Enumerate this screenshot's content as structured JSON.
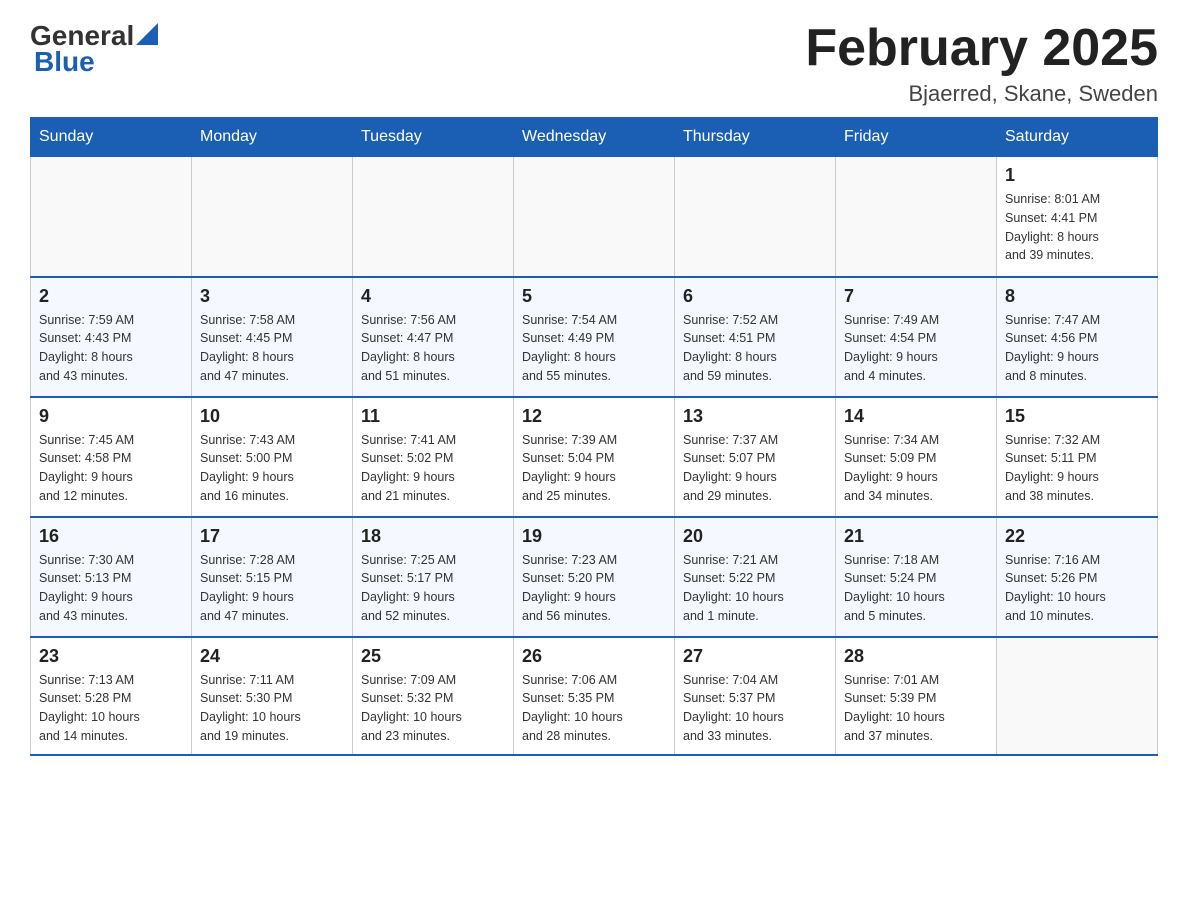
{
  "header": {
    "logo_general": "General",
    "logo_blue": "Blue",
    "month_title": "February 2025",
    "location": "Bjaerred, Skane, Sweden"
  },
  "weekdays": [
    "Sunday",
    "Monday",
    "Tuesday",
    "Wednesday",
    "Thursday",
    "Friday",
    "Saturday"
  ],
  "weeks": [
    {
      "days": [
        {
          "number": "",
          "info": ""
        },
        {
          "number": "",
          "info": ""
        },
        {
          "number": "",
          "info": ""
        },
        {
          "number": "",
          "info": ""
        },
        {
          "number": "",
          "info": ""
        },
        {
          "number": "",
          "info": ""
        },
        {
          "number": "1",
          "info": "Sunrise: 8:01 AM\nSunset: 4:41 PM\nDaylight: 8 hours\nand 39 minutes."
        }
      ]
    },
    {
      "days": [
        {
          "number": "2",
          "info": "Sunrise: 7:59 AM\nSunset: 4:43 PM\nDaylight: 8 hours\nand 43 minutes."
        },
        {
          "number": "3",
          "info": "Sunrise: 7:58 AM\nSunset: 4:45 PM\nDaylight: 8 hours\nand 47 minutes."
        },
        {
          "number": "4",
          "info": "Sunrise: 7:56 AM\nSunset: 4:47 PM\nDaylight: 8 hours\nand 51 minutes."
        },
        {
          "number": "5",
          "info": "Sunrise: 7:54 AM\nSunset: 4:49 PM\nDaylight: 8 hours\nand 55 minutes."
        },
        {
          "number": "6",
          "info": "Sunrise: 7:52 AM\nSunset: 4:51 PM\nDaylight: 8 hours\nand 59 minutes."
        },
        {
          "number": "7",
          "info": "Sunrise: 7:49 AM\nSunset: 4:54 PM\nDaylight: 9 hours\nand 4 minutes."
        },
        {
          "number": "8",
          "info": "Sunrise: 7:47 AM\nSunset: 4:56 PM\nDaylight: 9 hours\nand 8 minutes."
        }
      ]
    },
    {
      "days": [
        {
          "number": "9",
          "info": "Sunrise: 7:45 AM\nSunset: 4:58 PM\nDaylight: 9 hours\nand 12 minutes."
        },
        {
          "number": "10",
          "info": "Sunrise: 7:43 AM\nSunset: 5:00 PM\nDaylight: 9 hours\nand 16 minutes."
        },
        {
          "number": "11",
          "info": "Sunrise: 7:41 AM\nSunset: 5:02 PM\nDaylight: 9 hours\nand 21 minutes."
        },
        {
          "number": "12",
          "info": "Sunrise: 7:39 AM\nSunset: 5:04 PM\nDaylight: 9 hours\nand 25 minutes."
        },
        {
          "number": "13",
          "info": "Sunrise: 7:37 AM\nSunset: 5:07 PM\nDaylight: 9 hours\nand 29 minutes."
        },
        {
          "number": "14",
          "info": "Sunrise: 7:34 AM\nSunset: 5:09 PM\nDaylight: 9 hours\nand 34 minutes."
        },
        {
          "number": "15",
          "info": "Sunrise: 7:32 AM\nSunset: 5:11 PM\nDaylight: 9 hours\nand 38 minutes."
        }
      ]
    },
    {
      "days": [
        {
          "number": "16",
          "info": "Sunrise: 7:30 AM\nSunset: 5:13 PM\nDaylight: 9 hours\nand 43 minutes."
        },
        {
          "number": "17",
          "info": "Sunrise: 7:28 AM\nSunset: 5:15 PM\nDaylight: 9 hours\nand 47 minutes."
        },
        {
          "number": "18",
          "info": "Sunrise: 7:25 AM\nSunset: 5:17 PM\nDaylight: 9 hours\nand 52 minutes."
        },
        {
          "number": "19",
          "info": "Sunrise: 7:23 AM\nSunset: 5:20 PM\nDaylight: 9 hours\nand 56 minutes."
        },
        {
          "number": "20",
          "info": "Sunrise: 7:21 AM\nSunset: 5:22 PM\nDaylight: 10 hours\nand 1 minute."
        },
        {
          "number": "21",
          "info": "Sunrise: 7:18 AM\nSunset: 5:24 PM\nDaylight: 10 hours\nand 5 minutes."
        },
        {
          "number": "22",
          "info": "Sunrise: 7:16 AM\nSunset: 5:26 PM\nDaylight: 10 hours\nand 10 minutes."
        }
      ]
    },
    {
      "days": [
        {
          "number": "23",
          "info": "Sunrise: 7:13 AM\nSunset: 5:28 PM\nDaylight: 10 hours\nand 14 minutes."
        },
        {
          "number": "24",
          "info": "Sunrise: 7:11 AM\nSunset: 5:30 PM\nDaylight: 10 hours\nand 19 minutes."
        },
        {
          "number": "25",
          "info": "Sunrise: 7:09 AM\nSunset: 5:32 PM\nDaylight: 10 hours\nand 23 minutes."
        },
        {
          "number": "26",
          "info": "Sunrise: 7:06 AM\nSunset: 5:35 PM\nDaylight: 10 hours\nand 28 minutes."
        },
        {
          "number": "27",
          "info": "Sunrise: 7:04 AM\nSunset: 5:37 PM\nDaylight: 10 hours\nand 33 minutes."
        },
        {
          "number": "28",
          "info": "Sunrise: 7:01 AM\nSunset: 5:39 PM\nDaylight: 10 hours\nand 37 minutes."
        },
        {
          "number": "",
          "info": ""
        }
      ]
    }
  ]
}
